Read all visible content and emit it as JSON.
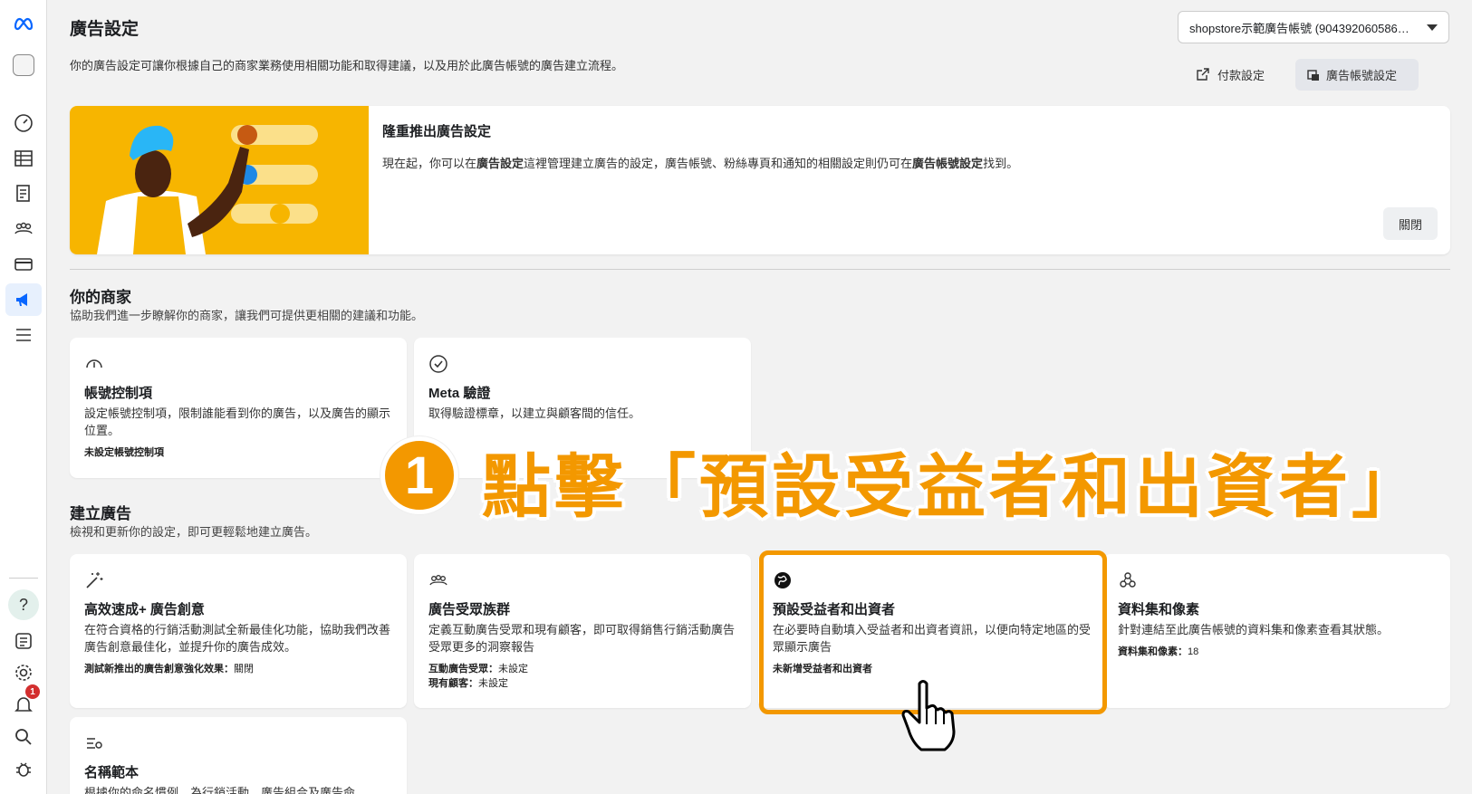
{
  "header": {
    "title": "廣告設定",
    "description": "你的廣告設定可讓你根據自己的商家業務使用相關功能和取得建議，以及用於此廣告帳號的廣告建立流程。",
    "account_select": "shopstore示範廣告帳號 (904392060586…",
    "payment_settings": "付款設定",
    "account_settings": "廣告帳號設定"
  },
  "banner": {
    "title": "隆重推出廣告設定",
    "text_part1": "現在起，你可以在",
    "text_bold1": "廣告設定",
    "text_part2": "這裡管理建立廣告的設定，廣告帳號、粉絲專頁和通知的相關設定則仍可在",
    "text_bold2": "廣告帳號設定",
    "text_part3": "找到。",
    "close_label": "關閉"
  },
  "your_business": {
    "title": "你的商家",
    "description": "協助我們進一步瞭解你的商家，讓我們可提供更相關的建議和功能。",
    "cards": [
      {
        "icon": "gauge-icon",
        "title": "帳號控制項",
        "description": "設定帳號控制項，限制誰能看到你的廣告，以及廣告的顯示位置。",
        "status": "未設定帳號控制項"
      },
      {
        "icon": "verified-check-icon",
        "title": "Meta 驗證",
        "description": "取得驗證標章，以建立與顧客間的信任。"
      }
    ]
  },
  "create_ads": {
    "title": "建立廣告",
    "description": "檢視和更新你的設定，即可更輕鬆地建立廣告。",
    "cards": [
      {
        "icon": "magic-wand-icon",
        "title": "高效速成+ 廣告創意",
        "description": "在符合資格的行銷活動測試全新最佳化功能，協助我們改善廣告創意最佳化，並提升你的廣告成效。",
        "status_label": "測試新推出的廣告創意強化效果：",
        "status_value": "關閉"
      },
      {
        "icon": "audience-icon",
        "title": "廣告受眾族群",
        "description": "定義互動廣告受眾和現有顧客，即可取得銷售行銷活動廣告受眾更多的洞察報告",
        "status_label": "互動廣告受眾：",
        "status_value": "未設定",
        "status2_label": "現有顧客：",
        "status2_value": "未設定"
      },
      {
        "icon": "globe-icon",
        "title": "預設受益者和出資者",
        "description": "在必要時自動填入受益者和出資者資訊，以便向特定地區的受眾顯示廣告",
        "status": "未新增受益者和出資者"
      },
      {
        "icon": "dataset-icon",
        "title": "資料集和像素",
        "description": "針對連結至此廣告帳號的資料集和像素查看其狀態。",
        "status_label": "資料集和像素：",
        "status_value": "18"
      },
      {
        "icon": "naming-template-icon",
        "title": "名稱範本",
        "description": "根據你的命名慣例，為行銷活動、廣告組合及廣告命"
      }
    ]
  },
  "annotation": {
    "step_number": "1",
    "instruction": "點擊「預設受益者和出資者」"
  },
  "sidebar": {
    "notification_count": "1"
  },
  "colors": {
    "accent": "#f39800",
    "banner_bg": "#f7b500",
    "meta_blue": "#0866ff"
  }
}
